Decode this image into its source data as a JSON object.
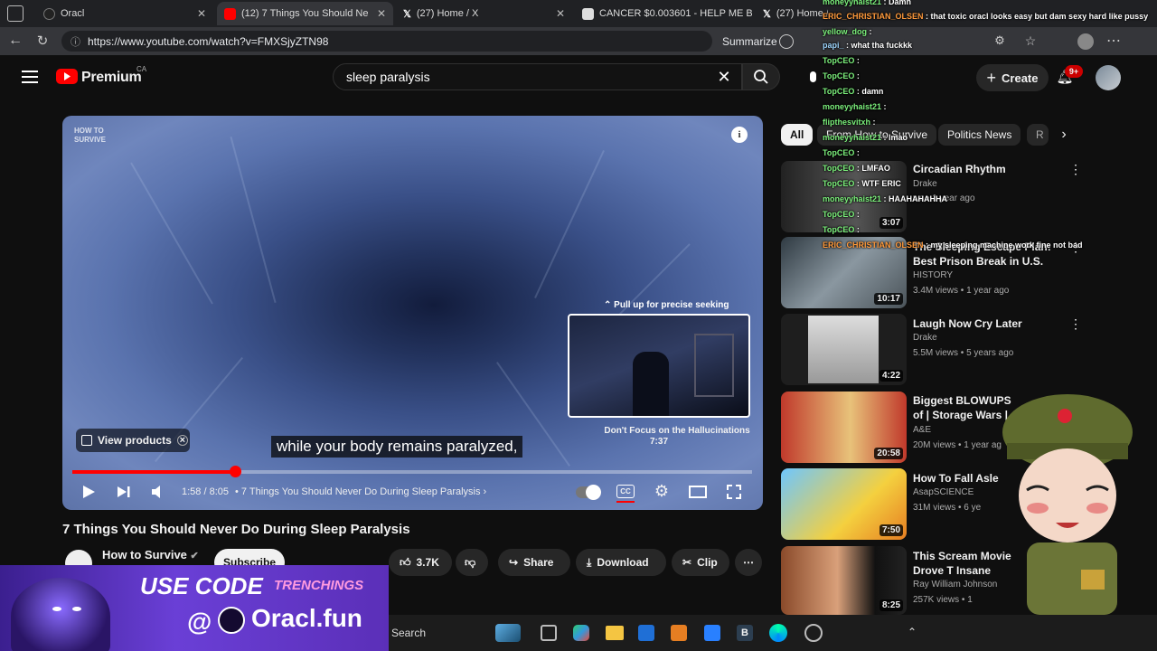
{
  "browser": {
    "tabs": [
      {
        "label": "Oracl"
      },
      {
        "label": "(12) 7 Things You Should Ne"
      },
      {
        "label": "(27) Home / X"
      },
      {
        "label": "CANCER $0.003601 - HELP ME BE"
      },
      {
        "label": "(27) Home / X"
      }
    ],
    "url": "https://www.youtube.com/watch?v=FMXSjyZTN98",
    "summarize_label": "Summarize"
  },
  "header": {
    "logo": "Premium",
    "region": "CA",
    "search_query": "sleep paralysis",
    "create_label": "Create",
    "notif_count": "9+"
  },
  "player": {
    "watermark_line1": "HOW TO",
    "watermark_line2": "SURVIVE",
    "seek_hint": "Pull up for precise seeking",
    "preview_chapter": "Don't Focus on the Hallucinations",
    "preview_time": "7:37",
    "caption": "while your body remains paralyzed,",
    "view_products": "View products",
    "time": "1:58 / 8:05",
    "chapter": "7 Things You Should Never Do During Sleep Paralysis",
    "progress_fraction": 0.24
  },
  "video": {
    "title": "7 Things You Should Never Do During Sleep Paralysis",
    "channel": "How to Survive",
    "subscribe": "Subscribe",
    "likes": "3.7K",
    "share": "Share",
    "download": "Download",
    "clip": "Clip"
  },
  "chips": [
    "All",
    "From How to Survive",
    "Politics News",
    "R"
  ],
  "recommendations": [
    {
      "title": "Circadian Rhythm",
      "channel": "Drake",
      "meta": "ws • 1 year ago",
      "duration": "3:07"
    },
    {
      "title": "The Sleeping Escape Plan: Best Prison Break in U.S. History | ...",
      "channel": "HISTORY",
      "meta": "3.4M views • 1 year ago",
      "duration": "10:17"
    },
    {
      "title": "Laugh Now Cry Later",
      "channel": "Drake",
      "meta": "5.5M views • 5 years ago",
      "duration": "4:22"
    },
    {
      "title": "Biggest BLOWUPS of | Storage Wars | A",
      "channel": "A&E",
      "meta": "20M views • 1 year ag",
      "duration": "20:58"
    },
    {
      "title": "How To Fall Asle",
      "channel": "AsapSCIENCE",
      "meta": "31M views • 6 ye",
      "duration": "7:50"
    },
    {
      "title": "This Scream Movie Drove T Insane",
      "channel": "Ray William Johnson",
      "meta": "257K views • 1",
      "duration": "8:25"
    }
  ],
  "chat": [
    {
      "user": "moneyyhaist21",
      "msg": "Damn",
      "c": "cn-g"
    },
    {
      "user": "ERIC_CHRISTIAN_OLSEN",
      "msg": "that toxic oracl looks easy but dam sexy hard like pussy",
      "c": "cn-o"
    },
    {
      "user": "yellow_dog",
      "msg": "",
      "c": "cn-g"
    },
    {
      "user": "papi_",
      "msg": "what tha fuckkk",
      "c": "cn-b"
    },
    {
      "user": "TopCEO",
      "msg": "",
      "c": "cn-g"
    },
    {
      "user": "TopCEO",
      "msg": "",
      "c": "cn-g"
    },
    {
      "user": "TopCEO",
      "msg": "damn",
      "c": "cn-g"
    },
    {
      "user": "moneyyhaist21",
      "msg": "",
      "c": "cn-g"
    },
    {
      "user": "flipthesvitxh",
      "msg": "",
      "c": "cn-g"
    },
    {
      "user": "moneyyhaist21",
      "msg": "lmao",
      "c": "cn-g"
    },
    {
      "user": "TopCEO",
      "msg": "",
      "c": "cn-g"
    },
    {
      "user": "TopCEO",
      "msg": "LMFAO",
      "c": "cn-g"
    },
    {
      "user": "TopCEO",
      "msg": "WTF ERIC",
      "c": "cn-g"
    },
    {
      "user": "moneyyhaist21",
      "msg": "HAAHAHAHHA",
      "c": "cn-g"
    },
    {
      "user": "TopCEO",
      "msg": "",
      "c": "cn-g"
    },
    {
      "user": "TopCEO",
      "msg": "",
      "c": "cn-g"
    },
    {
      "user": "ERIC_CHRISTIAN_OLSEN",
      "msg": "my sleeping machine work fine not bad",
      "c": "cn-o"
    }
  ],
  "banner": {
    "line1": "USE CODE",
    "code": "TRENCHINGS",
    "line2": "Oracl.fun"
  },
  "taskbar": {
    "search": "Search"
  },
  "colors": {
    "accent": "#ff0000",
    "bg": "#0f0f0f",
    "chip_active": "#f1f1f1"
  }
}
